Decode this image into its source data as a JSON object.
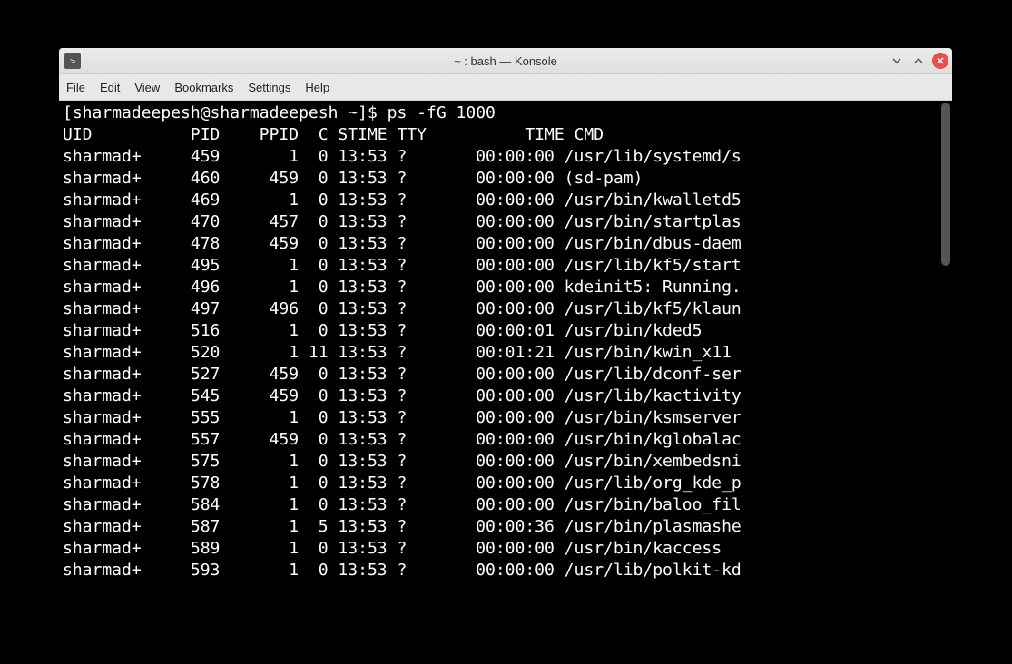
{
  "window": {
    "title": "~ : bash — Konsole",
    "app_icon_glyph": ">"
  },
  "menu": {
    "items": [
      "File",
      "Edit",
      "View",
      "Bookmarks",
      "Settings",
      "Help"
    ]
  },
  "prompt": {
    "open": "[",
    "user_host": "sharmadeepesh@sharmadeepesh",
    "path": " ~",
    "close": "]",
    "dollar": "$ ",
    "command": "ps -fG 1000"
  },
  "header": "UID          PID    PPID  C STIME TTY          TIME CMD",
  "rows": [
    {
      "uid": "sharmad+",
      "pid": "459",
      "ppid": "1",
      "c": "0",
      "stime": "13:53",
      "tty": "?",
      "time": "00:00:00",
      "cmd": "/usr/lib/systemd/s"
    },
    {
      "uid": "sharmad+",
      "pid": "460",
      "ppid": "459",
      "c": "0",
      "stime": "13:53",
      "tty": "?",
      "time": "00:00:00",
      "cmd": "(sd-pam)"
    },
    {
      "uid": "sharmad+",
      "pid": "469",
      "ppid": "1",
      "c": "0",
      "stime": "13:53",
      "tty": "?",
      "time": "00:00:00",
      "cmd": "/usr/bin/kwalletd5"
    },
    {
      "uid": "sharmad+",
      "pid": "470",
      "ppid": "457",
      "c": "0",
      "stime": "13:53",
      "tty": "?",
      "time": "00:00:00",
      "cmd": "/usr/bin/startplas"
    },
    {
      "uid": "sharmad+",
      "pid": "478",
      "ppid": "459",
      "c": "0",
      "stime": "13:53",
      "tty": "?",
      "time": "00:00:00",
      "cmd": "/usr/bin/dbus-daem"
    },
    {
      "uid": "sharmad+",
      "pid": "495",
      "ppid": "1",
      "c": "0",
      "stime": "13:53",
      "tty": "?",
      "time": "00:00:00",
      "cmd": "/usr/lib/kf5/start"
    },
    {
      "uid": "sharmad+",
      "pid": "496",
      "ppid": "1",
      "c": "0",
      "stime": "13:53",
      "tty": "?",
      "time": "00:00:00",
      "cmd": "kdeinit5: Running."
    },
    {
      "uid": "sharmad+",
      "pid": "497",
      "ppid": "496",
      "c": "0",
      "stime": "13:53",
      "tty": "?",
      "time": "00:00:00",
      "cmd": "/usr/lib/kf5/klaun"
    },
    {
      "uid": "sharmad+",
      "pid": "516",
      "ppid": "1",
      "c": "0",
      "stime": "13:53",
      "tty": "?",
      "time": "00:00:01",
      "cmd": "/usr/bin/kded5"
    },
    {
      "uid": "sharmad+",
      "pid": "520",
      "ppid": "1",
      "c": "11",
      "stime": "13:53",
      "tty": "?",
      "time": "00:01:21",
      "cmd": "/usr/bin/kwin_x11"
    },
    {
      "uid": "sharmad+",
      "pid": "527",
      "ppid": "459",
      "c": "0",
      "stime": "13:53",
      "tty": "?",
      "time": "00:00:00",
      "cmd": "/usr/lib/dconf-ser"
    },
    {
      "uid": "sharmad+",
      "pid": "545",
      "ppid": "459",
      "c": "0",
      "stime": "13:53",
      "tty": "?",
      "time": "00:00:00",
      "cmd": "/usr/lib/kactivity"
    },
    {
      "uid": "sharmad+",
      "pid": "555",
      "ppid": "1",
      "c": "0",
      "stime": "13:53",
      "tty": "?",
      "time": "00:00:00",
      "cmd": "/usr/bin/ksmserver"
    },
    {
      "uid": "sharmad+",
      "pid": "557",
      "ppid": "459",
      "c": "0",
      "stime": "13:53",
      "tty": "?",
      "time": "00:00:00",
      "cmd": "/usr/bin/kglobalac"
    },
    {
      "uid": "sharmad+",
      "pid": "575",
      "ppid": "1",
      "c": "0",
      "stime": "13:53",
      "tty": "?",
      "time": "00:00:00",
      "cmd": "/usr/bin/xembedsni"
    },
    {
      "uid": "sharmad+",
      "pid": "578",
      "ppid": "1",
      "c": "0",
      "stime": "13:53",
      "tty": "?",
      "time": "00:00:00",
      "cmd": "/usr/lib/org_kde_p"
    },
    {
      "uid": "sharmad+",
      "pid": "584",
      "ppid": "1",
      "c": "0",
      "stime": "13:53",
      "tty": "?",
      "time": "00:00:00",
      "cmd": "/usr/bin/baloo_fil"
    },
    {
      "uid": "sharmad+",
      "pid": "587",
      "ppid": "1",
      "c": "5",
      "stime": "13:53",
      "tty": "?",
      "time": "00:00:36",
      "cmd": "/usr/bin/plasmashe"
    },
    {
      "uid": "sharmad+",
      "pid": "589",
      "ppid": "1",
      "c": "0",
      "stime": "13:53",
      "tty": "?",
      "time": "00:00:00",
      "cmd": "/usr/bin/kaccess"
    },
    {
      "uid": "sharmad+",
      "pid": "593",
      "ppid": "1",
      "c": "0",
      "stime": "13:53",
      "tty": "?",
      "time": "00:00:00",
      "cmd": "/usr/lib/polkit-kd"
    }
  ]
}
